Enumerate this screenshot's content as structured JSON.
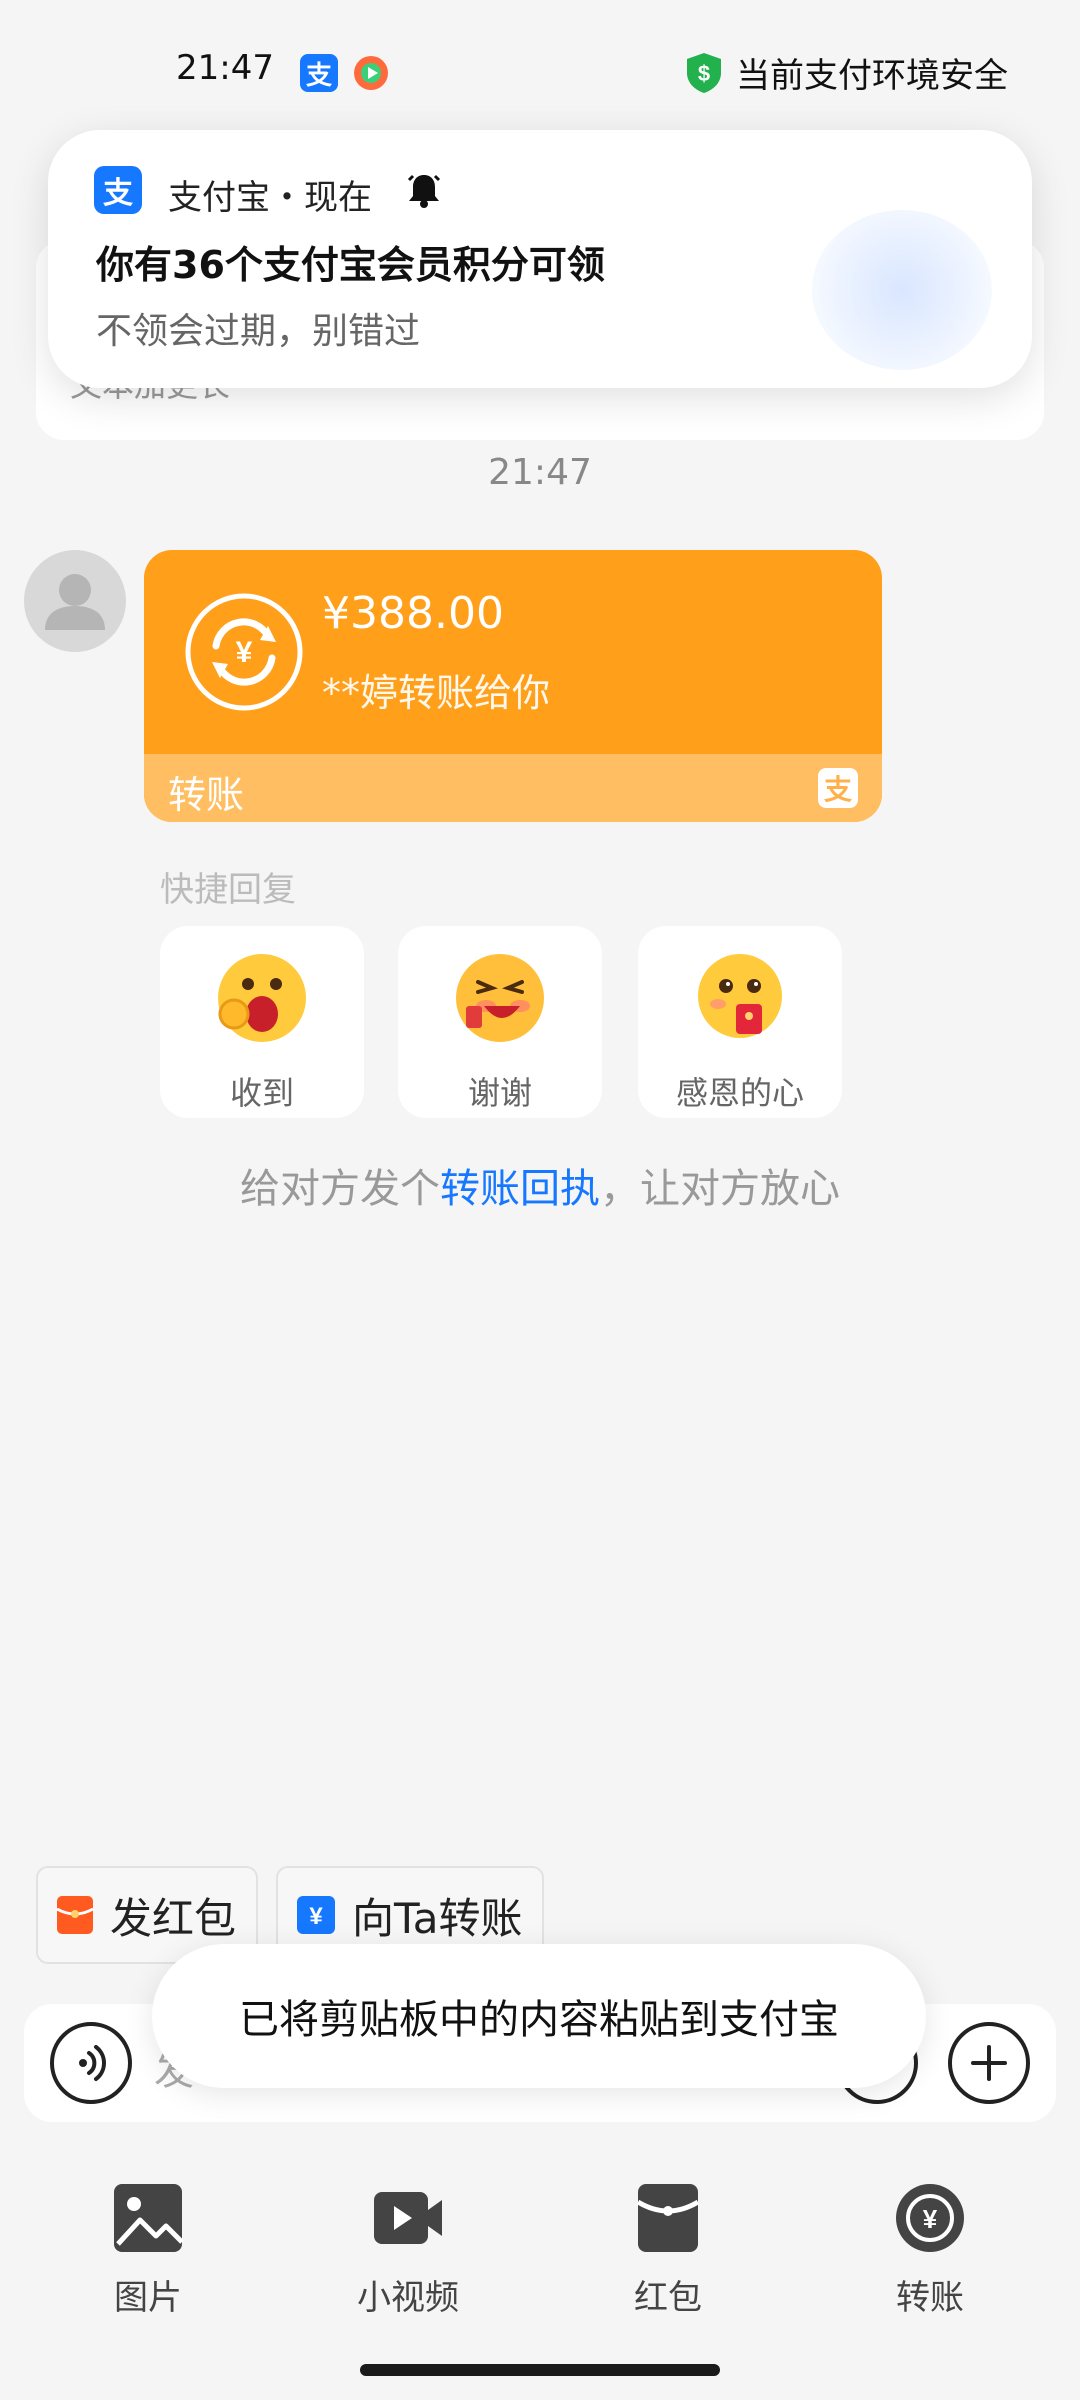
{
  "status_bar": {
    "time": "21:47",
    "secure_text": "当前支付环境安全",
    "alipay_glyph": "支"
  },
  "notification": {
    "app_name": "支付宝・现在",
    "title": "你有36个支付宝会员积分可领",
    "body": "不领会过期，别错过"
  },
  "behind_card": {
    "text": "文本加更长"
  },
  "chat": {
    "timestamp": "21:47",
    "transfer": {
      "amount": "¥388.00",
      "desc": "**婷转账给你",
      "footer_label": "转账",
      "logo_glyph": "支"
    },
    "quick_reply_label": "快捷回复",
    "quick_replies": [
      {
        "label": "收到"
      },
      {
        "label": "谢谢"
      },
      {
        "label": "感恩的心"
      }
    ],
    "receipt": {
      "prefix": "给对方发个",
      "link": "转账回执",
      "suffix": "，让对方放心"
    }
  },
  "actions": {
    "hongbao": "发红包",
    "transfer": "向Ta转账"
  },
  "input": {
    "placeholder": "发"
  },
  "toast": {
    "text": "已将剪贴板中的内容粘贴到支付宝"
  },
  "toolbar": {
    "items": [
      {
        "label": "图片",
        "icon": "image-icon"
      },
      {
        "label": "小视频",
        "icon": "video-icon"
      },
      {
        "label": "红包",
        "icon": "red-packet-icon"
      },
      {
        "label": "转账",
        "icon": "transfer-icon"
      }
    ]
  },
  "colors": {
    "accent": "#1677ff",
    "transfer_orange": "#ff9f1a",
    "secure_green": "#22b14c"
  }
}
